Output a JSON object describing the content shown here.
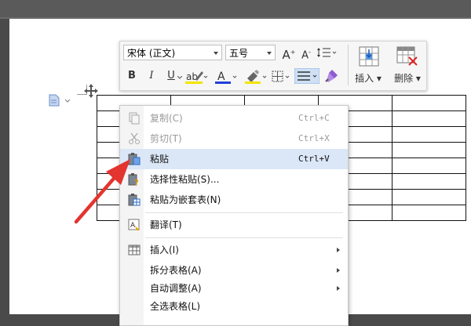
{
  "toolbar": {
    "font_name": "宋体 (正文)",
    "font_size": "五号",
    "bold": "B",
    "italic": "I",
    "underline": "U",
    "grow_font": "A",
    "shrink_font": "A",
    "insert_label": "插入",
    "delete_label": "删除"
  },
  "context_menu": {
    "items": [
      {
        "label": "复制(C)",
        "shortcut": "Ctrl+C",
        "icon": "copy-icon",
        "disabled": true
      },
      {
        "label": "剪切(T)",
        "shortcut": "Ctrl+X",
        "icon": "scissors-icon",
        "disabled": true
      },
      {
        "label": "粘贴",
        "shortcut": "Ctrl+V",
        "icon": "paste-icon",
        "highlighted": true
      },
      {
        "label": "选择性粘贴(S)...",
        "icon": "paste-special-icon"
      },
      {
        "label": "粘贴为嵌套表(N)",
        "icon": "paste-nested-table-icon"
      },
      {
        "label": "翻译(T)",
        "icon": "translate-icon"
      },
      {
        "label": "插入(I)",
        "icon": "table-grid-icon",
        "submenu": true
      },
      {
        "label": "拆分表格(A)",
        "submenu": true
      },
      {
        "label": "自动调整(A)",
        "submenu": true
      },
      {
        "label": "全选表格(L)"
      }
    ]
  },
  "colors": {
    "highlight": "#dbe7f7",
    "arrow": "#e3342f",
    "font_color_bar": "#1f3fd8",
    "highlighter_bar": "#f2e400"
  }
}
